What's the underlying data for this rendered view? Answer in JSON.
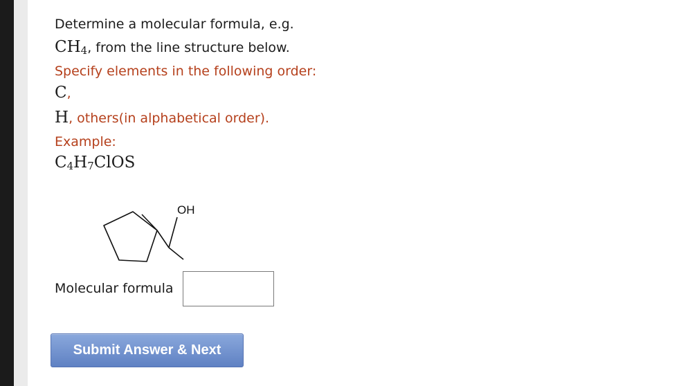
{
  "question": {
    "line1": "Determine a molecular formula, e.g.",
    "example_formula": {
      "base": "CH",
      "sub": "4"
    },
    "line2_rest": ", from the line structure below.",
    "order_instruction": "Specify elements in the following order:",
    "order_c": "C",
    "order_comma": ",",
    "order_h": "H",
    "order_rest": ", others(in alphabetical order).",
    "example_label": "Example:",
    "example2": {
      "c": "C",
      "c_sub": "4",
      "h": "H",
      "h_sub": "7",
      "rest": "ClOS"
    }
  },
  "structure": {
    "substituent_label": "OH"
  },
  "answer": {
    "label": "Molecular formula",
    "value": "",
    "placeholder": ""
  },
  "submit_label": "Submit Answer & Next",
  "colors": {
    "instruction_text": "#b5401c",
    "button_top": "#8aa8dc",
    "button_bottom": "#5f81c3"
  }
}
